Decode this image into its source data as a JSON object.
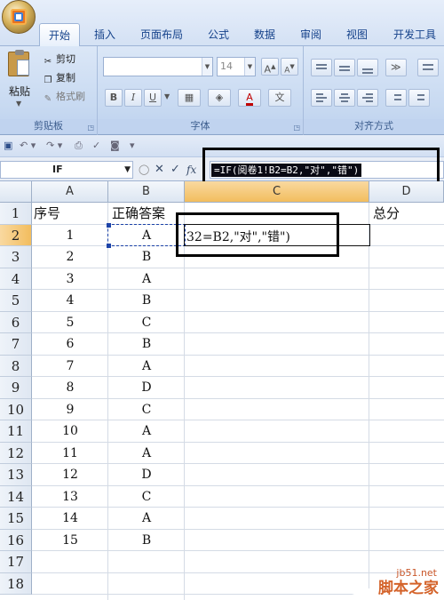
{
  "ribbon": {
    "tabs": [
      "开始",
      "插入",
      "页面布局",
      "公式",
      "数据",
      "审阅",
      "视图",
      "开发工具"
    ],
    "active_tab": "开始",
    "clipboard": {
      "paste": "粘贴",
      "cut": "剪切",
      "copy": "复制",
      "format_painter": "格式刷",
      "label": "剪贴板"
    },
    "font": {
      "size": "14",
      "bold": "B",
      "italic": "I",
      "underline": "U",
      "grow": "A",
      "shrink": "A",
      "color_a": "A",
      "label": "字体"
    },
    "alignment": {
      "label": "对齐方式"
    }
  },
  "formula_bar": {
    "name_box": "IF",
    "cancel": "✕",
    "enter": "✓",
    "fx": "fx",
    "formula": "=IF(阅卷1!B2=B2,\"对\",\"错\")"
  },
  "sheet": {
    "columns": [
      "A",
      "B",
      "C",
      "D"
    ],
    "selected_column": "C",
    "selected_row": "2",
    "rows": [
      {
        "n": "1",
        "a": "序号",
        "b": "正确答案",
        "d": "总分"
      },
      {
        "n": "2",
        "a": "1",
        "b": "A"
      },
      {
        "n": "3",
        "a": "2",
        "b": "B"
      },
      {
        "n": "4",
        "a": "3",
        "b": "A"
      },
      {
        "n": "5",
        "a": "4",
        "b": "B"
      },
      {
        "n": "6",
        "a": "5",
        "b": "C"
      },
      {
        "n": "7",
        "a": "6",
        "b": "B"
      },
      {
        "n": "8",
        "a": "7",
        "b": "A"
      },
      {
        "n": "9",
        "a": "8",
        "b": "D"
      },
      {
        "n": "10",
        "a": "9",
        "b": "C"
      },
      {
        "n": "11",
        "a": "10",
        "b": "A"
      },
      {
        "n": "12",
        "a": "11",
        "b": "A"
      },
      {
        "n": "13",
        "a": "12",
        "b": "D"
      },
      {
        "n": "14",
        "a": "13",
        "b": "C"
      },
      {
        "n": "15",
        "a": "14",
        "b": "A"
      },
      {
        "n": "16",
        "a": "15",
        "b": "B"
      },
      {
        "n": "17",
        "a": "",
        "b": ""
      },
      {
        "n": "18",
        "a": "",
        "b": ""
      }
    ],
    "editing_text": "32=B2,\"对\",\"错\")"
  },
  "watermark": {
    "url": "jb51.net",
    "name": "脚本之家"
  }
}
